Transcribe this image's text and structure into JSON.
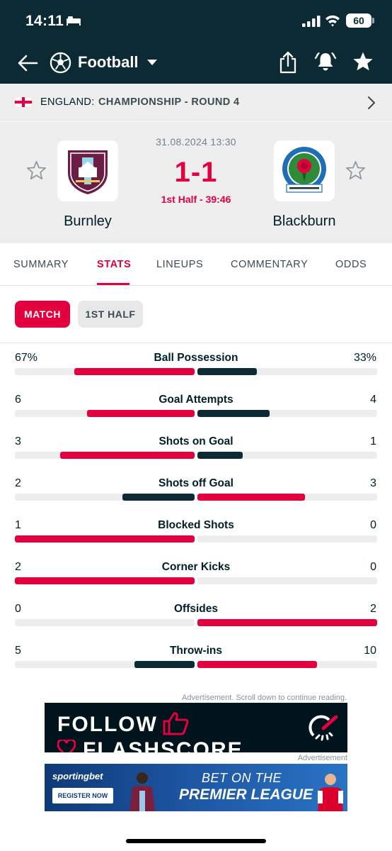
{
  "status_bar": {
    "time": "14:11",
    "battery": "60"
  },
  "app_bar": {
    "title": "Football"
  },
  "league": {
    "country": "ENGLAND:",
    "name": "CHAMPIONSHIP - ROUND 4"
  },
  "match": {
    "datetime": "31.08.2024 13:30",
    "score": "1-1",
    "status": "1st Half - 39:46",
    "home_team": "Burnley",
    "away_team": "Blackburn"
  },
  "tabs": [
    {
      "label": "SUMMARY"
    },
    {
      "label": "STATS"
    },
    {
      "label": "LINEUPS"
    },
    {
      "label": "COMMENTARY"
    },
    {
      "label": "ODDS"
    }
  ],
  "periods": {
    "match": "MATCH",
    "first_half": "1ST HALF"
  },
  "stats": [
    {
      "label": "Ball Possession",
      "home": "67%",
      "away": "33%",
      "home_val": 67,
      "away_val": 33
    },
    {
      "label": "Goal Attempts",
      "home": "6",
      "away": "4",
      "home_val": 6,
      "away_val": 4
    },
    {
      "label": "Shots on Goal",
      "home": "3",
      "away": "1",
      "home_val": 3,
      "away_val": 1
    },
    {
      "label": "Shots off Goal",
      "home": "2",
      "away": "3",
      "home_val": 2,
      "away_val": 3
    },
    {
      "label": "Blocked Shots",
      "home": "1",
      "away": "0",
      "home_val": 1,
      "away_val": 0
    },
    {
      "label": "Corner Kicks",
      "home": "2",
      "away": "0",
      "home_val": 2,
      "away_val": 0
    },
    {
      "label": "Offsides",
      "home": "0",
      "away": "2",
      "home_val": 0,
      "away_val": 2
    },
    {
      "label": "Throw-ins",
      "home": "5",
      "away": "10",
      "home_val": 5,
      "away_val": 10
    }
  ],
  "ads": {
    "note": "Advertisement. Scroll down to continue reading.",
    "banner1_line1": "FOLLOW",
    "banner1_line2": "FLASHSCORE",
    "note2": "Advertisement",
    "banner2_brand": "sportingbet",
    "banner2_register": "REGISTER NOW",
    "banner2_line1": "BET ON THE",
    "banner2_line2": "PREMIER LEAGUE"
  },
  "colors": {
    "accent": "#e4003f",
    "dark": "#0b2a33",
    "track": "#ededed"
  }
}
